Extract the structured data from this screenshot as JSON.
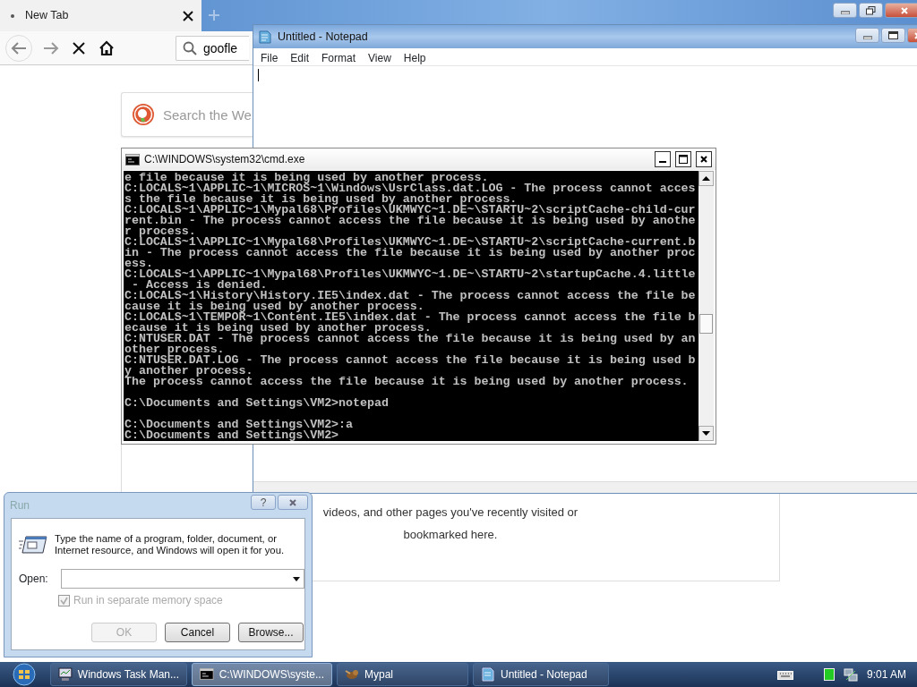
{
  "browser": {
    "tab": {
      "title": "New Tab"
    },
    "search_field": {
      "value": "goofle"
    },
    "web_search": {
      "placeholder": "Search the We"
    },
    "content_lines": [
      "videos, and other pages you've recently visited or",
      "bookmarked here."
    ]
  },
  "notepad": {
    "title": "Untitled - Notepad",
    "menu": [
      "File",
      "Edit",
      "Format",
      "View",
      "Help"
    ]
  },
  "cmd": {
    "title": "C:\\WINDOWS\\system32\\cmd.exe",
    "blocks": [
      [
        "e file because it is being used by another process.",
        "C:LOCALS~1\\APPLIC~1\\MICROS~1\\Windows\\UsrClass.dat.LOG - The process cannot acces",
        "s the file because it is being used by another process.",
        "C:LOCALS~1\\APPLIC~1\\Mypal68\\Profiles\\UKMWYC~1.DE~\\STARTU~2\\scriptCache-child-cur",
        "rent.bin - The process cannot access the file because it is being used by anothe",
        "r process.",
        "C:LOCALS~1\\APPLIC~1\\Mypal68\\Profiles\\UKMWYC~1.DE~\\STARTU~2\\scriptCache-current.b",
        "in - The process cannot access the file because it is being used by another proc",
        "ess.",
        "C:LOCALS~1\\APPLIC~1\\Mypal68\\Profiles\\UKMWYC~1.DE~\\STARTU~2\\startupCache.4.little",
        " - Access is denied.",
        "C:LOCALS~1\\History\\History.IE5\\index.dat - The process cannot access the file be",
        "cause it is being used by another process.",
        "C:LOCALS~1\\TEMPOR~1\\Content.IE5\\index.dat - The process cannot access the file b",
        "ecause it is being used by another process.",
        "C:NTUSER.DAT - The process cannot access the file because it is being used by an",
        "other process.",
        "C:NTUSER.DAT.LOG - The process cannot access the file because it is being used b",
        "y another process.",
        "The process cannot access the file because it is being used by another process."
      ],
      [
        "C:\\Documents and Settings\\VM2>notepad"
      ],
      [
        "C:\\Documents and Settings\\VM2>:a",
        "C:\\Documents and Settings\\VM2>"
      ]
    ]
  },
  "run_dialog": {
    "title": "Run",
    "help": "?",
    "description": "Type the name of a program, folder, document, or Internet resource, and Windows will open it for you.",
    "open_label": "Open:",
    "checkbox": {
      "label": "Run in separate memory space",
      "checked": true,
      "disabled": true
    },
    "buttons": [
      {
        "label": "OK",
        "disabled": true
      },
      {
        "label": "Cancel",
        "disabled": false
      },
      {
        "label": "Browse...",
        "disabled": false
      }
    ]
  },
  "taskbar": {
    "items": [
      {
        "label": "Windows Task Man...",
        "kind": "taskmgr",
        "selected": false
      },
      {
        "label": "C:\\WINDOWS\\syste...",
        "kind": "cmd",
        "selected": true
      },
      {
        "label": "Mypal",
        "kind": "browser",
        "selected": false
      },
      {
        "label": "Untitled - Notepad",
        "kind": "notepad",
        "selected": false
      }
    ],
    "clock": "9:01 AM"
  }
}
